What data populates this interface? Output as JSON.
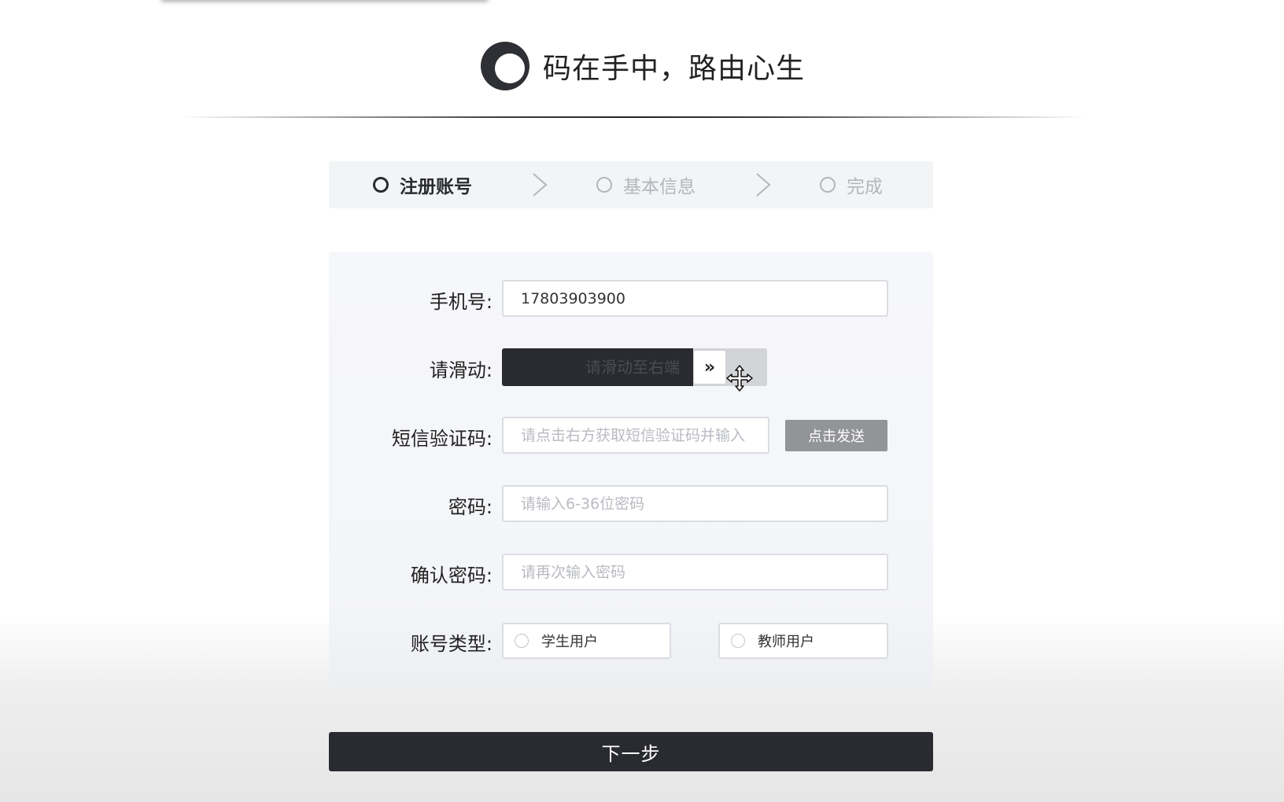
{
  "header": {
    "logo_icon": "circle-logo-icon",
    "title": "码在手中，路由心生"
  },
  "steps": [
    {
      "label": "注册账号",
      "state": "active"
    },
    {
      "label": "基本信息",
      "state": "inactive"
    },
    {
      "label": "完成",
      "state": "inactive"
    }
  ],
  "form": {
    "phone": {
      "label": "手机号:",
      "value": "17803903900"
    },
    "slider": {
      "label": "请滑动:",
      "text": "请滑动至右端",
      "handle_glyph": "»",
      "progress": 0.72
    },
    "sms": {
      "label": "短信验证码:",
      "placeholder": "请点击右方获取短信验证码并输入",
      "send_label": "点击发送"
    },
    "password": {
      "label": "密码:",
      "placeholder": "请输入6-36位密码"
    },
    "confirm": {
      "label": "确认密码:",
      "placeholder": "请再次输入密码"
    },
    "account_type": {
      "label": "账号类型:",
      "options": [
        "学生用户",
        "教师用户"
      ]
    }
  },
  "next_label": "下一步",
  "colors": {
    "accent": "#2a2b30",
    "inactive": "#b4b6bd",
    "send_button": "#939498",
    "panel": "#f6f7fa"
  }
}
